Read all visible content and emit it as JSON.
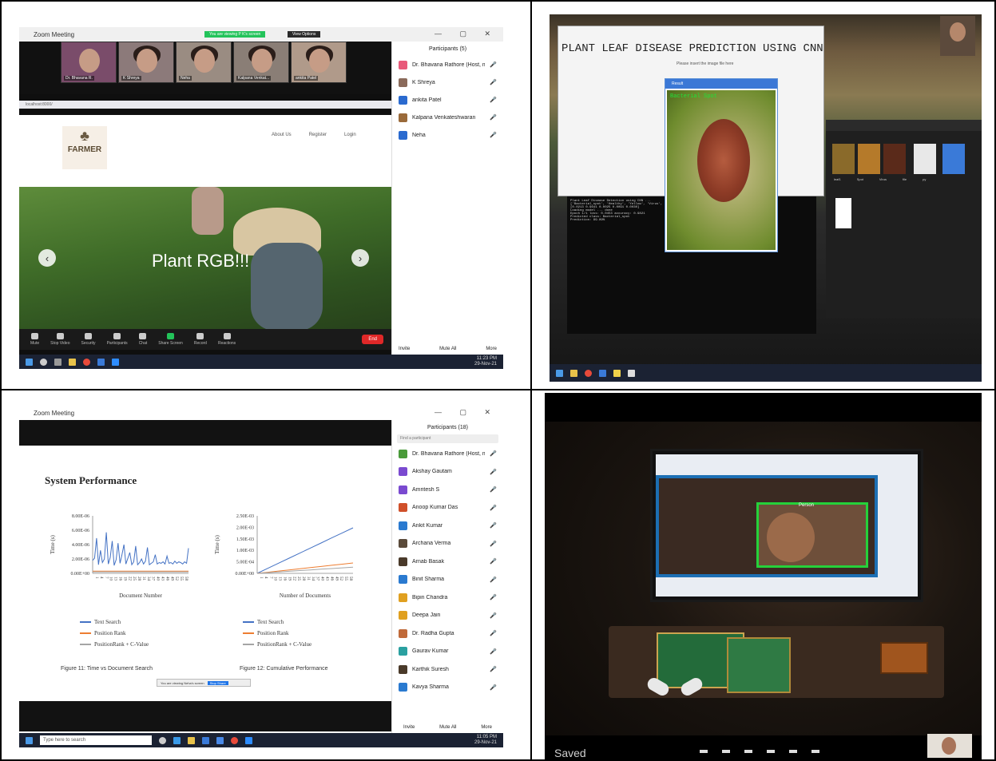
{
  "panel1": {
    "window_title": "Zoom Meeting",
    "banner_recording": "You are viewing P K's screen",
    "banner_options": "View Options",
    "participants_title": "Participants (5)",
    "participants": [
      {
        "name": "Dr. Bhavana Rathore (Host, me)",
        "color": "#e85a7a"
      },
      {
        "name": "K Shreya",
        "color": "#8a6a5a"
      },
      {
        "name": "ankita Patel",
        "color": "#2a6acf"
      },
      {
        "name": "Kalpana Venkateshwaran",
        "color": "#9a6a3a"
      },
      {
        "name": "Neha",
        "color": "#2a6acf"
      }
    ],
    "tiles": [
      "Dr. Bhavana R.",
      "K Shreya",
      "Neha",
      "Kalpana Venkat...",
      "ankita Patel"
    ],
    "browser_url": "localhost:8000/",
    "site_logo": "FARMER",
    "nav": [
      "About Us",
      "Register",
      "Login"
    ],
    "hero_text": "Plant RGB!!!",
    "controls": [
      "Mute",
      "Stop Video",
      "Security",
      "Participants",
      "Chat",
      "Share Screen",
      "Record",
      "Reactions"
    ],
    "end_label": "End",
    "footer_buttons": [
      "Invite",
      "Mute All",
      "More"
    ],
    "clock_time": "11:23 PM",
    "clock_date": "29-Nov-21"
  },
  "panel2": {
    "app_title": "PLANT LEAF DISEASE PREDICTION USING CNN",
    "app_sub": "Please insert the image file here",
    "leaf_window_title": "Result",
    "prediction": "Bacterial Spot",
    "console_lines": [
      "Plant Leaf Disease Detection using CNN ...",
      "['Bacterial_spot', 'Healthy', 'Yellow', 'Virus', 'Late']",
      "[0.0213 0.9641 0.0025 0.0091 0.0030]",
      "Loading model ... done",
      "Epoch 1/1  loss: 0.0453  accuracy: 0.9821",
      "Predicted class: Bacterial_spot",
      "Prediction: 99.89%"
    ],
    "explorer_labels": [
      "leaf1",
      "Spot",
      "Virus",
      "file",
      "py"
    ]
  },
  "panel3": {
    "window_title": "Zoom Meeting",
    "participants_title": "Participants (18)",
    "search_placeholder": "Find a participant",
    "participants": [
      {
        "name": "Dr. Bhavana Rathore (Host, me)",
        "color": "#4a9a3a"
      },
      {
        "name": "Akshay Gautam",
        "color": "#7a4ad0"
      },
      {
        "name": "Amritesh S",
        "color": "#7a4ad0"
      },
      {
        "name": "Anoop Kumar Das",
        "color": "#d0502a"
      },
      {
        "name": "Ankit Kumar",
        "color": "#2a7ad0"
      },
      {
        "name": "Archana Verma",
        "color": "#5a4a3a"
      },
      {
        "name": "Arnab Basak",
        "color": "#4a3a2a"
      },
      {
        "name": "Binit Sharma",
        "color": "#2a7ad0"
      },
      {
        "name": "Bipin Chandra",
        "color": "#e0a020"
      },
      {
        "name": "Deepa Jain",
        "color": "#e0a020"
      },
      {
        "name": "Dr. Radha Gupta",
        "color": "#c06a3a"
      },
      {
        "name": "Gaurav Kumar",
        "color": "#2aa0a0"
      },
      {
        "name": "Karthik Suresh",
        "color": "#4a3a2a"
      },
      {
        "name": "Kavya Sharma",
        "color": "#2a7ad0"
      }
    ],
    "footer_buttons": [
      "Invite",
      "Mute All",
      "More"
    ],
    "search_box": "Type here to search",
    "clock_time": "11:05 PM",
    "clock_date": "29-Nov-21",
    "share_text": "You are viewing Neha's screen",
    "share_stop": "Stop Share"
  },
  "chart_data": [
    {
      "type": "line",
      "title": "System Performance",
      "caption": "Figure 11: Time vs Document Search",
      "xlabel": "Document Number",
      "ylabel": "Time (s)",
      "y_ticks": [
        "8.00E-06",
        "6.00E-06",
        "4.00E-06",
        "2.00E-06",
        "0.00E+00"
      ],
      "ylim": [
        0,
        8e-06
      ],
      "x_tick_labels": [
        "1",
        "4",
        "7",
        "10",
        "13",
        "16",
        "19",
        "22",
        "25",
        "28",
        "31",
        "34",
        "37",
        "40",
        "43",
        "46",
        "49",
        "52",
        "55",
        "58"
      ],
      "legend": [
        {
          "name": "Text Search",
          "color": "#4472c4"
        },
        {
          "name": "Position Rank",
          "color": "#ed7d31"
        },
        {
          "name": "PositionRank + C-Value",
          "color": "#a5a5a5"
        }
      ],
      "series": [
        {
          "name": "Text Search",
          "color": "#4472c4",
          "values": [
            1.8e-06,
            2.1e-06,
            4.9e-06,
            1.2e-06,
            3.2e-06,
            1.5e-06,
            2e-06,
            5.7e-06,
            1.3e-06,
            2.2e-06,
            4.5e-06,
            1.1e-06,
            1.9e-06,
            4.2e-06,
            1.4e-06,
            2.6e-06,
            4e-06,
            1.3e-06,
            2.1e-06,
            2.9e-06,
            1.2e-06,
            1.6e-06,
            3.8e-06,
            1.2e-06,
            1.5e-06,
            2e-06,
            1.3e-06,
            1.7e-06,
            3.6e-06,
            1.2e-06,
            1.4e-06,
            1.6e-06,
            2.6e-06,
            1.3e-06,
            1.5e-06,
            1.4e-06,
            1.6e-06,
            1.3e-06,
            2.4e-06,
            1.4e-06,
            1.5e-06,
            1.3e-06,
            1.7e-06,
            1.4e-06,
            1.6e-06,
            1.5e-06,
            1.3e-06,
            1.6e-06,
            1.4e-06,
            3.5e-06
          ]
        },
        {
          "name": "Position Rank",
          "color": "#ed7d31",
          "values": [
            3e-07,
            3e-07,
            3e-07,
            3e-07,
            3e-07,
            3e-07,
            3e-07,
            3e-07,
            3e-07,
            3e-07
          ]
        },
        {
          "name": "PositionRank + C-Value",
          "color": "#a5a5a5",
          "values": [
            2e-07,
            2e-07,
            2e-07,
            2e-07,
            2e-07,
            2e-07,
            2e-07,
            2e-07,
            2e-07,
            2e-07
          ]
        }
      ]
    },
    {
      "type": "line",
      "caption": "Figure 12: Cumulative Performance",
      "xlabel": "Number of Documents",
      "ylabel": "Time (s)",
      "y_ticks": [
        "2.50E-03",
        "2.00E-03",
        "1.50E-03",
        "1.00E-03",
        "5.00E-04",
        "0.00E+00"
      ],
      "ylim": [
        0,
        0.0025
      ],
      "x_tick_labels": [
        "1",
        "4",
        "7",
        "10",
        "13",
        "16",
        "19",
        "22",
        "25",
        "28",
        "31",
        "34",
        "37",
        "40",
        "43",
        "46",
        "49",
        "52",
        "55",
        "58"
      ],
      "legend": [
        {
          "name": "Text Search",
          "color": "#4472c4"
        },
        {
          "name": "Position Rank",
          "color": "#ed7d31"
        },
        {
          "name": "PositionRank + C-Value",
          "color": "#a5a5a5"
        }
      ],
      "series": [
        {
          "name": "Text Search",
          "color": "#4472c4",
          "values": [
            0,
            0.00022,
            0.00044,
            0.00066,
            0.00088,
            0.0011,
            0.00132,
            0.00154,
            0.00176,
            0.00198
          ]
        },
        {
          "name": "Position Rank",
          "color": "#ed7d31",
          "values": [
            0,
            5e-05,
            0.0001,
            0.00015,
            0.0002,
            0.00025,
            0.0003,
            0.00035,
            0.0004,
            0.00045
          ]
        },
        {
          "name": "PositionRank + C-Value",
          "color": "#a5a5a5",
          "values": [
            0,
            3e-05,
            6e-05,
            9e-05,
            0.00012,
            0.00015,
            0.00018,
            0.00021,
            0.00024,
            0.00027
          ]
        }
      ]
    }
  ],
  "panel4": {
    "saved_label": "Saved",
    "face_label": "Person"
  }
}
